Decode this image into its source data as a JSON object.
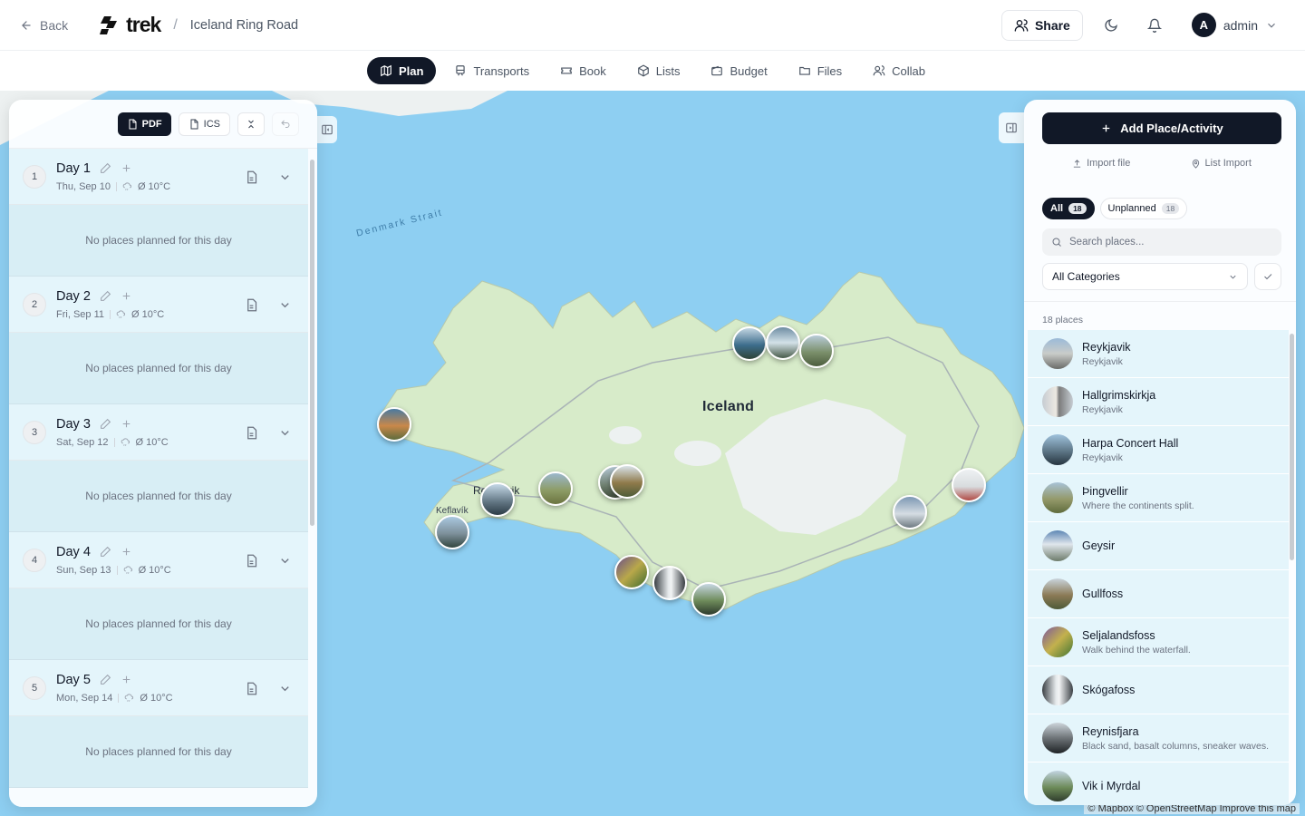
{
  "header": {
    "back_label": "Back",
    "logo_text": "trek",
    "separator": "/",
    "trip_title": "Iceland Ring Road",
    "share_label": "Share",
    "user_initial": "A",
    "user_name": "admin"
  },
  "tabs": [
    {
      "label": "Plan",
      "icon": "map-icon",
      "active": true
    },
    {
      "label": "Transports",
      "icon": "train-icon"
    },
    {
      "label": "Book",
      "icon": "ticket-icon"
    },
    {
      "label": "Lists",
      "icon": "package-icon"
    },
    {
      "label": "Budget",
      "icon": "wallet-icon"
    },
    {
      "label": "Files",
      "icon": "folder-icon"
    },
    {
      "label": "Collab",
      "icon": "users-icon"
    }
  ],
  "left_panel": {
    "pdf_label": "PDF",
    "ics_label": "ICS",
    "empty_text": "No places planned for this day",
    "days": [
      {
        "num": "1",
        "title": "Day 1",
        "date": "Thu, Sep 10",
        "weather": "Ø 10°C"
      },
      {
        "num": "2",
        "title": "Day 2",
        "date": "Fri, Sep 11",
        "weather": "Ø 10°C"
      },
      {
        "num": "3",
        "title": "Day 3",
        "date": "Sat, Sep 12",
        "weather": "Ø 10°C"
      },
      {
        "num": "4",
        "title": "Day 4",
        "date": "Sun, Sep 13",
        "weather": "Ø 10°C"
      },
      {
        "num": "5",
        "title": "Day 5",
        "date": "Mon, Sep 14",
        "weather": "Ø 10°C"
      }
    ]
  },
  "map": {
    "country_label": "Iceland",
    "strait_label": "Denmark Strait",
    "city_reykjavik": "Reykjavik",
    "city_keflavik": "Keflavík",
    "attribution": "© Mapbox © OpenStreetMap  Improve this map",
    "colors": {
      "water": "#8ecff2",
      "land": "#d7ebc9",
      "ice": "#edf1f1"
    }
  },
  "right_panel": {
    "add_label": "Add Place/Activity",
    "import_file_label": "Import file",
    "list_import_label": "List Import",
    "filter_all_label": "All",
    "filter_all_count": "18",
    "filter_unplanned_label": "Unplanned",
    "filter_unplanned_count": "18",
    "search_placeholder": "Search places...",
    "category_value": "All Categories",
    "count_label": "18 places",
    "places": [
      {
        "name": "Reykjavik",
        "sub": "Reykjavik"
      },
      {
        "name": "Hallgrimskirkja",
        "sub": "Reykjavik"
      },
      {
        "name": "Harpa Concert Hall",
        "sub": "Reykjavik"
      },
      {
        "name": "Þingvellir",
        "sub": "Where the continents split."
      },
      {
        "name": "Geysir",
        "sub": ""
      },
      {
        "name": "Gullfoss",
        "sub": ""
      },
      {
        "name": "Seljalandsfoss",
        "sub": "Walk behind the waterfall."
      },
      {
        "name": "Skógafoss",
        "sub": ""
      },
      {
        "name": "Reynisfjara",
        "sub": "Black sand, basalt columns, sneaker waves."
      },
      {
        "name": "Vik i Myrdal",
        "sub": ""
      }
    ]
  }
}
